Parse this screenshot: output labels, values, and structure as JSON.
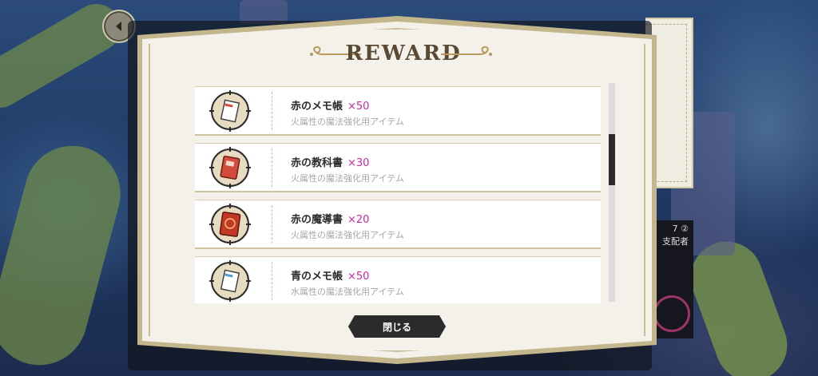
{
  "modal": {
    "title": "REWARD",
    "close_label": "閉じる"
  },
  "background": {
    "panel_line1": "7 ②",
    "panel_line2": "支配者"
  },
  "items": [
    {
      "name": "赤のメモ帳",
      "qty": "×50",
      "desc": "火属性の魔法強化用アイテム",
      "icon": "red-memo-pad-icon",
      "color": "#d24b3b"
    },
    {
      "name": "赤の教科書",
      "qty": "×30",
      "desc": "火属性の魔法強化用アイテム",
      "icon": "red-textbook-icon",
      "color": "#d24b3b"
    },
    {
      "name": "赤の魔導書",
      "qty": "×20",
      "desc": "火属性の魔法強化用アイテム",
      "icon": "red-grimoire-icon",
      "color": "#c4382a"
    },
    {
      "name": "青のメモ帳",
      "qty": "×50",
      "desc": "水属性の魔法強化用アイテム",
      "icon": "blue-memo-pad-icon",
      "color": "#4a9ec8"
    }
  ],
  "colors": {
    "accent_qty": "#d123a6",
    "frame": "#c3b68c",
    "panel_bg": "#f3f1ea"
  }
}
